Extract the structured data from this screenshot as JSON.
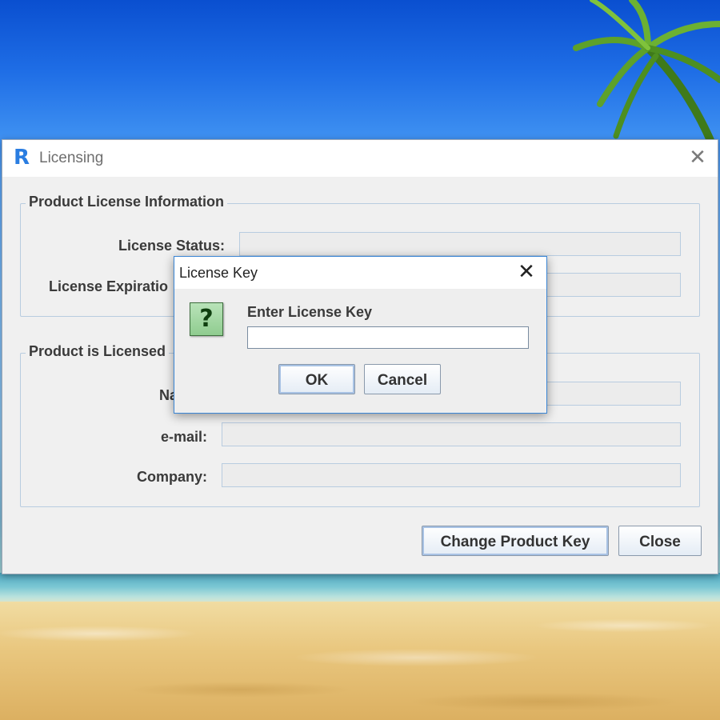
{
  "licensing_window": {
    "title": "Licensing",
    "logo_letter": "R",
    "close_glyph": "✕",
    "product_license_info": {
      "legend": "Product License Information",
      "license_status_label": "License Status:",
      "license_status_value": "",
      "license_expiration_label": "License Expiratio",
      "license_expiration_value": ""
    },
    "licensed_to": {
      "legend": "Product is Licensed",
      "name_label": "Na",
      "name_value": "",
      "email_label": "e-mail:",
      "email_value": "",
      "company_label": "Company:",
      "company_value": ""
    },
    "buttons": {
      "change_product_key": "Change Product Key",
      "close": "Close"
    }
  },
  "license_key_dialog": {
    "title": "License Key",
    "close_glyph": "✕",
    "icon_glyph": "?",
    "prompt": "Enter License Key",
    "input_value": "",
    "ok_label": "OK",
    "cancel_label": "Cancel"
  },
  "icons": {
    "app_logo": "r-logo-icon",
    "question": "question-icon",
    "close": "close-icon"
  },
  "colors": {
    "dialog_border": "#3a85d4",
    "logo": "#2a7de1",
    "question_icon_bg": "#8fcc8f"
  }
}
